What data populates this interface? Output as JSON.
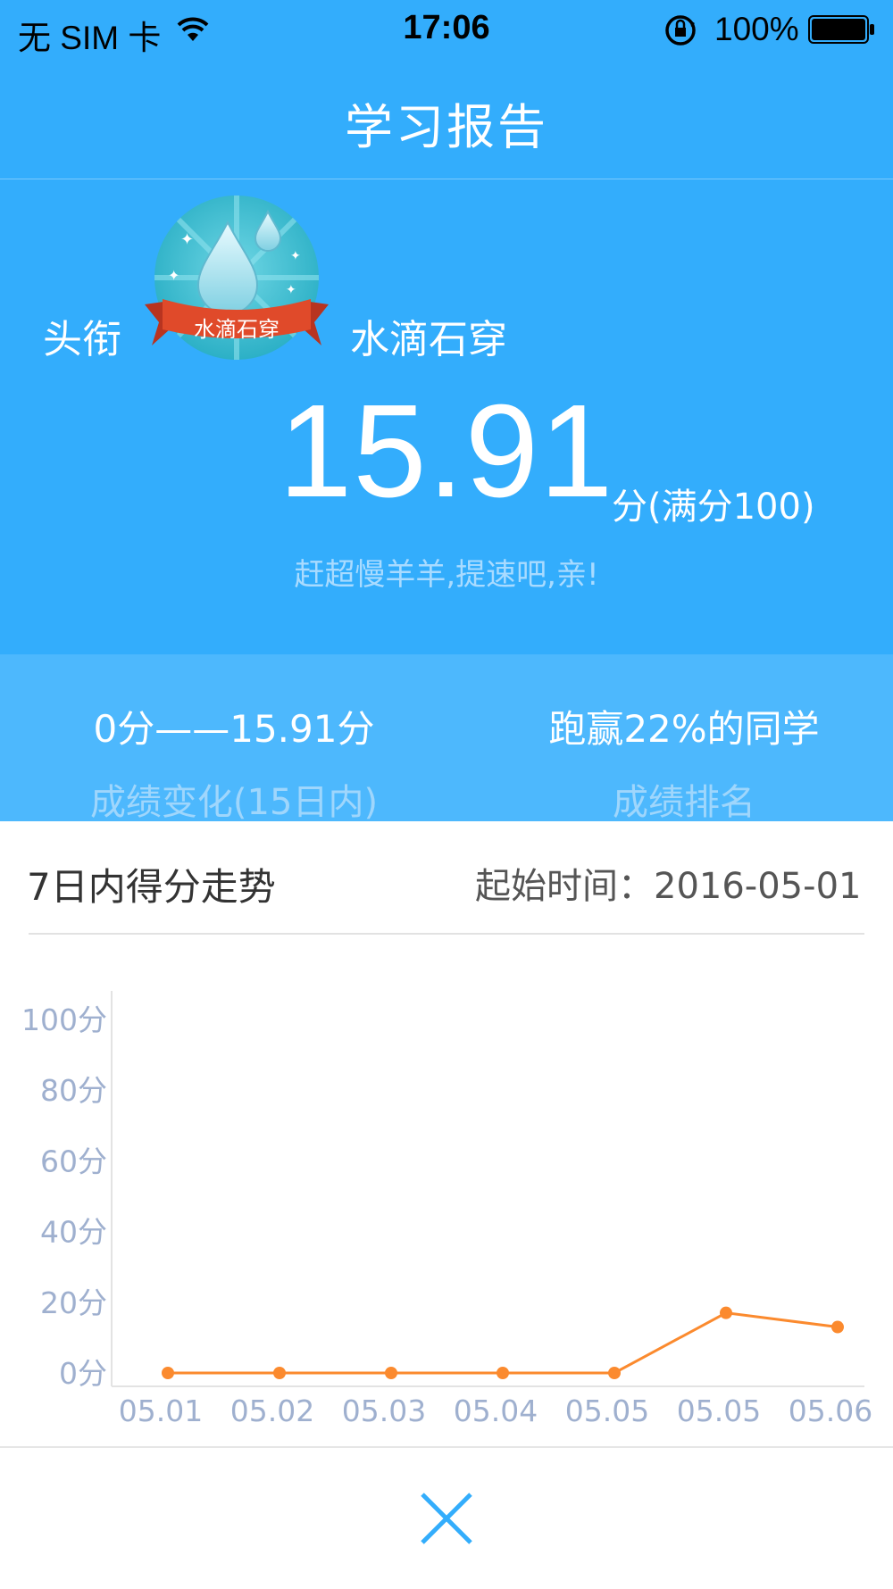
{
  "status_bar": {
    "carrier": "无 SIM 卡",
    "time": "17:06",
    "battery": "100%",
    "icons": [
      "wifi-icon",
      "orientation-lock-icon",
      "battery-icon"
    ]
  },
  "header": {
    "title": "学习报告"
  },
  "hero": {
    "title_label": "头衔",
    "badge_text": "水滴石穿",
    "title_value": "水滴石穿",
    "score": "15.91",
    "score_suffix": "分(满分100)",
    "encouragement": "赶超慢羊羊,提速吧,亲!"
  },
  "stats": {
    "change_value": "0分——15.91分",
    "change_label": "成绩变化(15日内)",
    "rank_value": "跑赢22%的同学",
    "rank_label": "成绩排名"
  },
  "trend": {
    "title": "7日内得分走势",
    "start_label": "起始时间：",
    "start_date": "2016-05-01"
  },
  "chart_data": {
    "type": "line",
    "categories": [
      "05.01",
      "05.02",
      "05.03",
      "05.04",
      "05.05",
      "05.05",
      "05.06"
    ],
    "series": [
      {
        "values": [
          0,
          0,
          0,
          0,
          0,
          17,
          13
        ]
      }
    ],
    "y_ticks": [
      "0分",
      "20分",
      "40分",
      "60分",
      "80分",
      "100分"
    ],
    "ylim": [
      0,
      100
    ],
    "grid": false,
    "colors": {
      "line": "#fb8a2e",
      "axis_text": "#9fb0cf"
    }
  },
  "colors": {
    "header_bg": "#33adfc",
    "stats_bg": "#4db8fd",
    "accent": "#33adfc"
  },
  "bottom": {
    "close_icon": "close-icon"
  }
}
